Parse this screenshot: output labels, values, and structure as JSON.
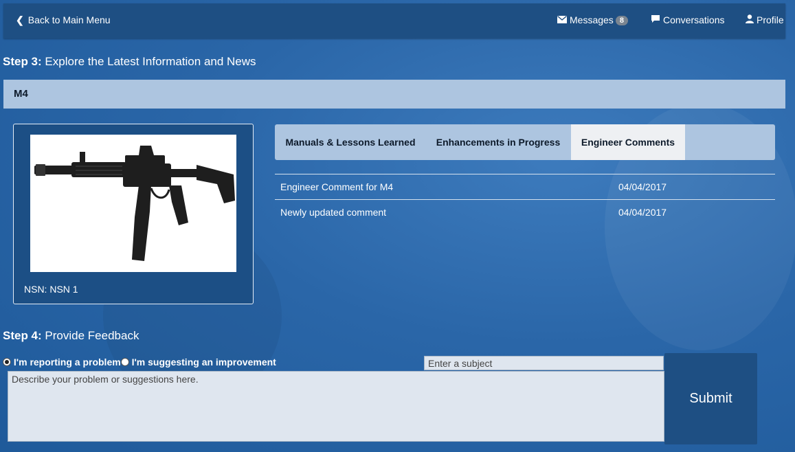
{
  "header": {
    "back_label": "Back to Main Menu",
    "messages_label": "Messages",
    "messages_count": "8",
    "conversations_label": "Conversations",
    "profile_label": "Profile"
  },
  "step3": {
    "prefix": "Step 3:",
    "title": "Explore the Latest Information and News"
  },
  "product": {
    "name": "M4",
    "nsn": "NSN: NSN 1"
  },
  "tabs": [
    {
      "label": "Manuals & Lessons Learned"
    },
    {
      "label": "Enhancements in Progress"
    },
    {
      "label": "Engineer Comments"
    }
  ],
  "active_tab": "Engineer Comments",
  "comments": [
    {
      "text": "Engineer Comment for M4",
      "date": "04/04/2017"
    },
    {
      "text": "Newly updated comment",
      "date": "04/04/2017"
    }
  ],
  "step4": {
    "prefix": "Step 4:",
    "title": "Provide Feedback"
  },
  "feedback": {
    "option_problem": "I'm reporting a problem",
    "option_improvement": "I'm suggesting an improvement",
    "selected": "I'm reporting a problem",
    "subject_placeholder": "Enter a subject",
    "description_placeholder": "Describe your problem or suggestions here.",
    "submit_label": "Submit"
  },
  "colors": {
    "background": "#2a66a8",
    "header": "#1e4f83",
    "bar": "#adc5e0",
    "active_tab": "#eef0f3"
  }
}
